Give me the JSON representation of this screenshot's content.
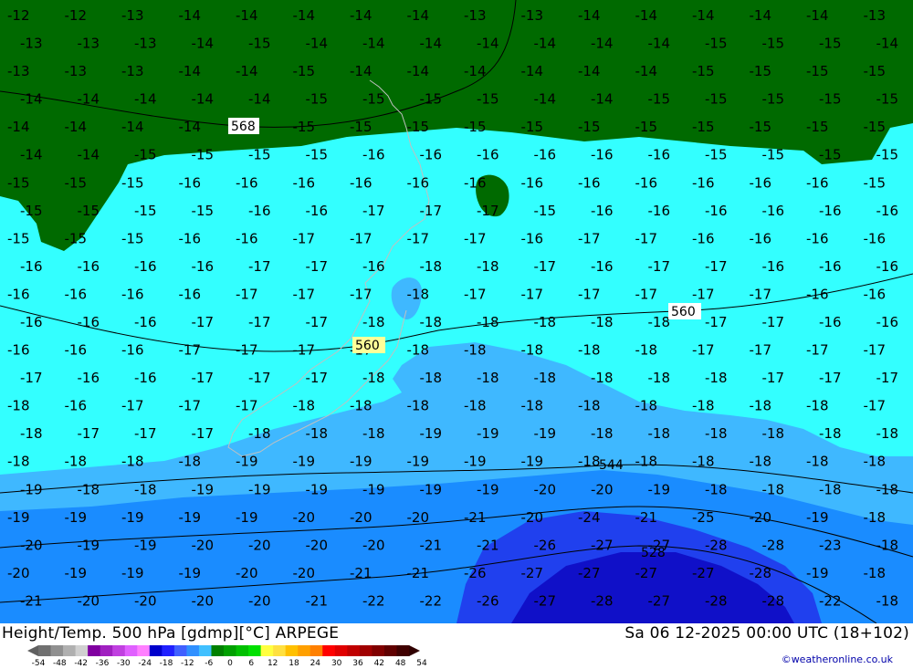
{
  "map": {
    "title_left": "Height/Temp. 500 hPa [gdmp][°C] ARPEGE",
    "title_right": "Sa 06 12-2025 00:00 UTC (18+102)",
    "credit": "©weatheronline.co.uk",
    "contour_labels": [
      "568",
      "560",
      "560",
      "544",
      "528"
    ],
    "legend": {
      "ticks": [
        "-54",
        "-48",
        "-42",
        "-36",
        "-30",
        "-24",
        "-18",
        "-12",
        "-6",
        "0",
        "6",
        "12",
        "18",
        "24",
        "30",
        "36",
        "42",
        "48",
        "54"
      ],
      "colors": [
        "#707070",
        "#909090",
        "#b0b0b0",
        "#d0d0d0",
        "#8000a0",
        "#a020c0",
        "#c040e0",
        "#e060ff",
        "#ff80ff",
        "#0000cc",
        "#2020ff",
        "#4060ff",
        "#3090ff",
        "#40c0ff",
        "#008000",
        "#00a000",
        "#00c000",
        "#00e000",
        "#ffff40",
        "#ffe040",
        "#ffc000",
        "#ffa000",
        "#ff8000",
        "#ff0000",
        "#e00000",
        "#c00000",
        "#a00000",
        "#800000",
        "#600000",
        "#400000"
      ]
    },
    "zone_colors": {
      "green": "#006a00",
      "cyan": "#33ffff",
      "light_blue": "#3fb8ff",
      "mid_blue": "#1a8cff",
      "blue": "#2040ee",
      "deep_blue": "#1010c8"
    }
  },
  "temperature_labels": [
    [
      "-12",
      "-12",
      "-13",
      "-14",
      "-14",
      "-14",
      "-14",
      "-14",
      "-13",
      "-13",
      "-14",
      "-14",
      "-14",
      "-14",
      "-14",
      "-13"
    ],
    [
      "-13",
      "-13",
      "-13",
      "-14",
      "-15",
      "-14",
      "-14",
      "-14",
      "-14",
      "-14",
      "-14",
      "-14",
      "-15",
      "-15",
      "-15",
      "-14"
    ],
    [
      "-13",
      "-13",
      "-13",
      "-14",
      "-14",
      "-15",
      "-14",
      "-14",
      "-14",
      "-14",
      "-14",
      "-14",
      "-15",
      "-15",
      "-15",
      "-15"
    ],
    [
      "-14",
      "-14",
      "-14",
      "-14",
      "-14",
      "-15",
      "-15",
      "-15",
      "-15",
      "-14",
      "-14",
      "-15",
      "-15",
      "-15",
      "-15",
      "-15"
    ],
    [
      "-14",
      "-14",
      "-14",
      "-14",
      "-15",
      "-15",
      "-15",
      "-15",
      "-15",
      "-15",
      "-15",
      "-15",
      "-15",
      "-15",
      "-15",
      "-15"
    ],
    [
      "-14",
      "-14",
      "-15",
      "-15",
      "-15",
      "-15",
      "-16",
      "-16",
      "-16",
      "-16",
      "-16",
      "-16",
      "-15",
      "-15",
      "-15",
      "-15"
    ],
    [
      "-15",
      "-15",
      "-15",
      "-16",
      "-16",
      "-16",
      "-16",
      "-16",
      "-16",
      "-16",
      "-16",
      "-16",
      "-16",
      "-16",
      "-16",
      "-15"
    ],
    [
      "-15",
      "-15",
      "-15",
      "-15",
      "-16",
      "-16",
      "-17",
      "-17",
      "-17",
      "-15",
      "-16",
      "-16",
      "-16",
      "-16",
      "-16",
      "-16"
    ],
    [
      "-15",
      "-15",
      "-15",
      "-16",
      "-16",
      "-17",
      "-17",
      "-17",
      "-17",
      "-16",
      "-17",
      "-17",
      "-16",
      "-16",
      "-16",
      "-16"
    ],
    [
      "-16",
      "-16",
      "-16",
      "-16",
      "-17",
      "-17",
      "-16",
      "-18",
      "-18",
      "-17",
      "-16",
      "-17",
      "-17",
      "-16",
      "-16",
      "-16"
    ],
    [
      "-16",
      "-16",
      "-16",
      "-16",
      "-17",
      "-17",
      "-17",
      "-18",
      "-17",
      "-17",
      "-17",
      "-17",
      "-17",
      "-17",
      "-16",
      "-16"
    ],
    [
      "-16",
      "-16",
      "-16",
      "-17",
      "-17",
      "-17",
      "-18",
      "-18",
      "-18",
      "-18",
      "-18",
      "-18",
      "-17",
      "-17",
      "-16",
      "-16"
    ],
    [
      "-16",
      "-16",
      "-16",
      "-17",
      "-17",
      "-17",
      "-17",
      "-18",
      "-18",
      "-18",
      "-18",
      "-18",
      "-17",
      "-17",
      "-17",
      "-17"
    ],
    [
      "-17",
      "-16",
      "-16",
      "-17",
      "-17",
      "-17",
      "-18",
      "-18",
      "-18",
      "-18",
      "-18",
      "-18",
      "-18",
      "-17",
      "-17",
      "-17"
    ],
    [
      "-18",
      "-16",
      "-17",
      "-17",
      "-17",
      "-18",
      "-18",
      "-18",
      "-18",
      "-18",
      "-18",
      "-18",
      "-18",
      "-18",
      "-18",
      "-17"
    ],
    [
      "-18",
      "-17",
      "-17",
      "-17",
      "-18",
      "-18",
      "-18",
      "-19",
      "-19",
      "-19",
      "-18",
      "-18",
      "-18",
      "-18",
      "-18",
      "-18"
    ],
    [
      "-18",
      "-18",
      "-18",
      "-18",
      "-19",
      "-19",
      "-19",
      "-19",
      "-19",
      "-19",
      "-18",
      "-18",
      "-18",
      "-18",
      "-18",
      "-18"
    ],
    [
      "-19",
      "-18",
      "-18",
      "-19",
      "-19",
      "-19",
      "-19",
      "-19",
      "-19",
      "-20",
      "-20",
      "-19",
      "-18",
      "-18",
      "-18",
      "-18"
    ],
    [
      "-19",
      "-19",
      "-19",
      "-19",
      "-19",
      "-20",
      "-20",
      "-20",
      "-21",
      "-20",
      "-24",
      "-21",
      "-25",
      "-20",
      "-19",
      "-18"
    ],
    [
      "-20",
      "-19",
      "-19",
      "-20",
      "-20",
      "-20",
      "-20",
      "-21",
      "-21",
      "-26",
      "-27",
      "-27",
      "-28",
      "-28",
      "-23",
      "-18"
    ],
    [
      "-20",
      "-19",
      "-19",
      "-19",
      "-20",
      "-20",
      "-21",
      "-21",
      "-26",
      "-27",
      "-27",
      "-27",
      "-27",
      "-28",
      "-19",
      "-18"
    ],
    [
      "-21",
      "-20",
      "-20",
      "-20",
      "-20",
      "-21",
      "-22",
      "-22",
      "-26",
      "-27",
      "-28",
      "-27",
      "-28",
      "-28",
      "-22",
      "-18"
    ]
  ]
}
